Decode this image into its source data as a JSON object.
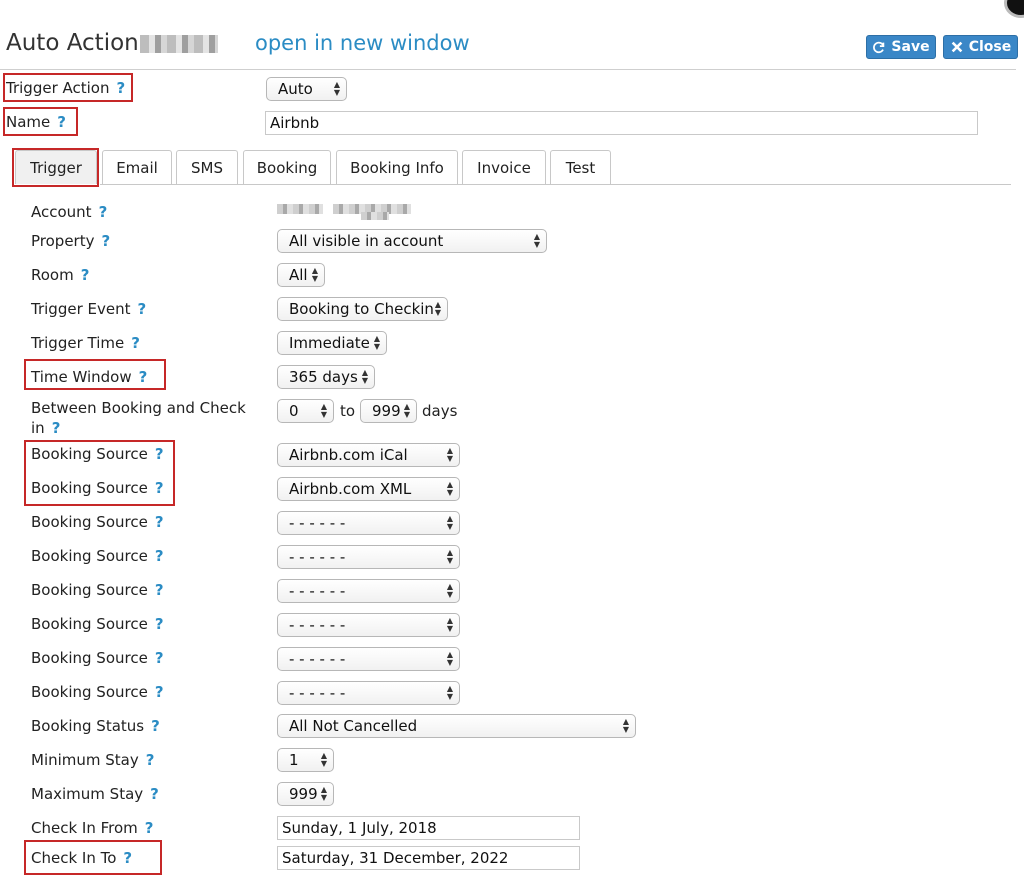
{
  "header": {
    "title": "Auto Action",
    "open_link": "open in new window",
    "save_label": "Save",
    "close_label": "Close"
  },
  "help_glyph": "?",
  "top_fields": {
    "trigger_action_label": "Trigger Action",
    "trigger_action_value": "Auto",
    "name_label": "Name",
    "name_value": "Airbnb"
  },
  "tabs": [
    "Trigger",
    "Email",
    "SMS",
    "Booking",
    "Booking Info",
    "Invoice",
    "Test"
  ],
  "form": {
    "account_label": "Account",
    "property_label": "Property",
    "property_value": "All visible in account",
    "room_label": "Room",
    "room_value": "All",
    "trigger_event_label": "Trigger Event",
    "trigger_event_value": "Booking to Checkin",
    "trigger_time_label": "Trigger Time",
    "trigger_time_value": "Immediate",
    "time_window_label": "Time Window",
    "time_window_value": "365 days",
    "between_label_line1": "Between Booking and Check",
    "between_label_line2": "in",
    "between_from": "0",
    "between_to_word": "to",
    "between_to": "999",
    "between_unit": "days",
    "booking_source_label": "Booking Source",
    "booking_sources": [
      "Airbnb.com iCal",
      "Airbnb.com XML",
      "- - - - - -",
      "- - - - - -",
      "- - - - - -",
      "- - - - - -",
      "- - - - - -",
      "- - - - - -"
    ],
    "booking_status_label": "Booking Status",
    "booking_status_value": "All Not Cancelled",
    "min_stay_label": "Minimum Stay",
    "min_stay_value": "1",
    "max_stay_label": "Maximum Stay",
    "max_stay_value": "999",
    "checkin_from_label": "Check In From",
    "checkin_from_value": "Sunday, 1 July, 2018",
    "checkin_to_label": "Check In To",
    "checkin_to_value": "Saturday, 31 December, 2022"
  },
  "colors": {
    "accent": "#2b8cc4",
    "button": "#3a87c7",
    "highlight": "#c62828"
  }
}
